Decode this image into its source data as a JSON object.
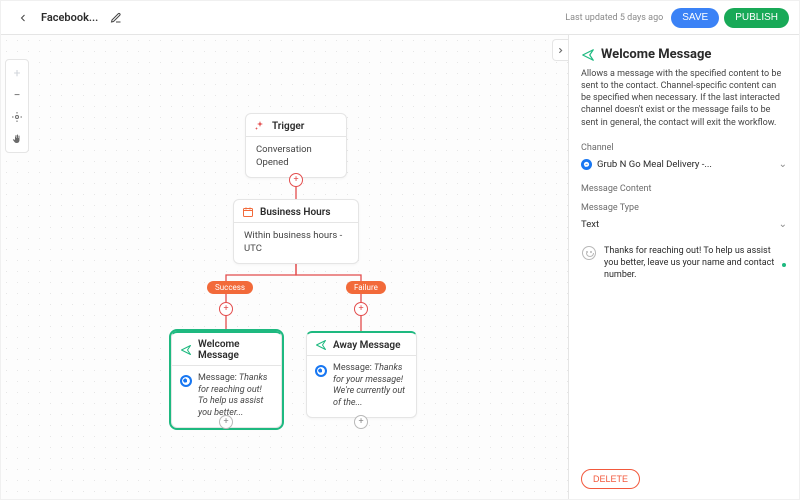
{
  "header": {
    "workflow_name": "Facebook...",
    "last_updated": "Last updated 5 days ago",
    "save": "SAVE",
    "publish": "PUBLISH"
  },
  "nodes": {
    "trigger": {
      "title": "Trigger",
      "detail": "Conversation Opened"
    },
    "hours": {
      "title": "Business Hours",
      "detail": "Within business hours - UTC"
    },
    "welcome": {
      "title": "Welcome Message",
      "prefix": "Message:",
      "preview": "Thanks for reaching out! To help us assist you better..."
    },
    "away": {
      "title": "Away Message",
      "prefix": "Message:",
      "preview": "Thanks for your message! We're currently out of the..."
    }
  },
  "badges": {
    "success": "Success",
    "failure": "Failure"
  },
  "panel": {
    "title": "Welcome Message",
    "description": "Allows a message with the specified content to be sent to the contact. Channel-specific content can be specified when necessary. If the last interacted channel doesn't exist or the message fails to be sent in general, the contact will exit the workflow.",
    "channel_label": "Channel",
    "channel_value": "Grub N Go Meal Delivery -...",
    "content_label": "Message Content",
    "type_label": "Message Type",
    "type_value": "Text",
    "message_body": "Thanks for reaching out! To help us assist you better, leave us your name and contact number.",
    "delete": "DELETE"
  },
  "colors": {
    "teal": "#1EB980",
    "orange": "#F26A3A",
    "edge": "#E74D3C",
    "blue": "#1877F2"
  }
}
